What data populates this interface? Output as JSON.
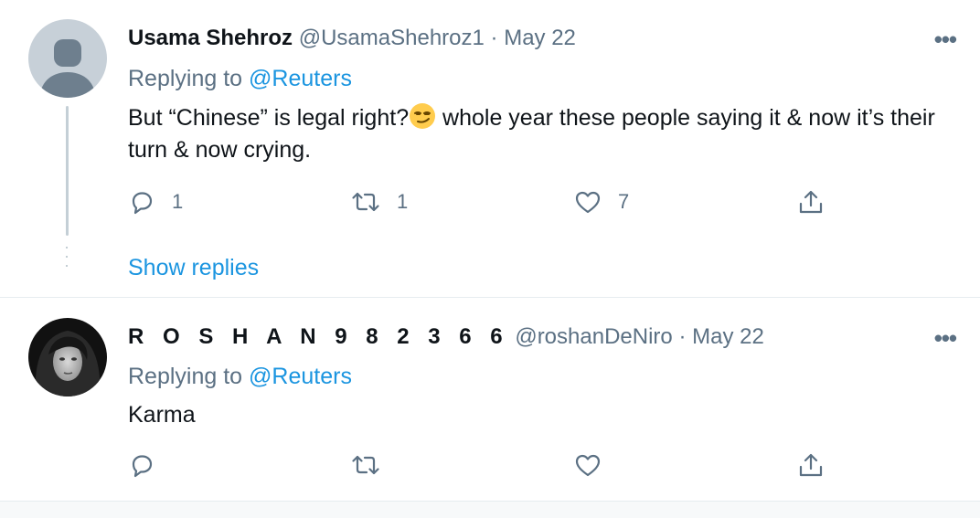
{
  "tweets": [
    {
      "author_name": "Usama Shehroz",
      "handle": "@UsamaShehroz1",
      "separator": "·",
      "date": "May 22",
      "more_label": "•••",
      "replying_prefix": "Replying to",
      "replying_to": "@Reuters",
      "text_part1": "But “Chinese” is legal right?",
      "text_part2": " whole year these people saying it & now it’s their turn & now crying.",
      "emoji": "smirking-face-emoji",
      "reply_count": "1",
      "retweet_count": "1",
      "like_count": "7",
      "show_replies": "Show replies"
    },
    {
      "author_name": "R O S H A N 9 8 2 3 6 6",
      "handle": "@roshanDeNiro",
      "separator": "·",
      "date": "May 22",
      "more_label": "•••",
      "replying_prefix": "Replying to",
      "replying_to": "@Reuters",
      "text": "Karma"
    }
  ],
  "colors": {
    "link": "#1b95e0",
    "secondary": "#5b7083",
    "primary_text": "#0f1419",
    "divider": "#e6ecf0",
    "thread_line": "#c4cfd6"
  },
  "icons": [
    "default-avatar-icon",
    "reply-icon",
    "retweet-icon",
    "like-icon",
    "share-icon",
    "more-icon"
  ]
}
